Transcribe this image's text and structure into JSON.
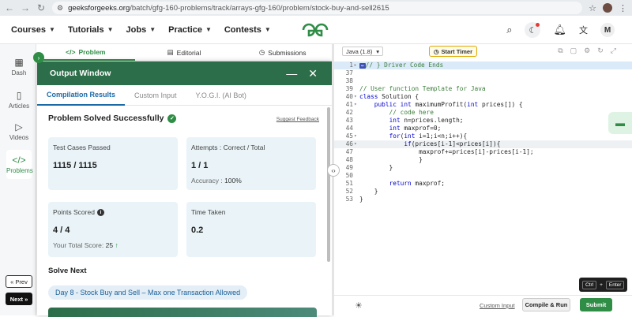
{
  "browser": {
    "url_host": "geeksforgeeks.org",
    "url_path": "/batch/gfg-160-problems/track/arrays-gfg-160/problem/stock-buy-and-sell2615"
  },
  "header": {
    "menu": [
      "Courses",
      "Tutorials",
      "Jobs",
      "Practice",
      "Contests"
    ],
    "avatar_letter": "M"
  },
  "rail": {
    "items": [
      "Dash",
      "Articles",
      "Videos",
      "Problems"
    ],
    "prev_label": "« Prev",
    "next_label": "Next »"
  },
  "problem_tabs": [
    "Problem",
    "Editorial",
    "Submissions"
  ],
  "output": {
    "title": "Output Window",
    "tabs": [
      "Compilation Results",
      "Custom Input",
      "Y.O.G.I. (AI Bot)"
    ],
    "result_title": "Problem Solved Successfully",
    "feedback": "Suggest Feedback",
    "cards": {
      "test_label": "Test Cases Passed",
      "test_value": "1115 / 1115",
      "attempts_label": "Attempts : Correct / Total",
      "attempts_value": "1 / 1",
      "accuracy_label": "Accuracy :",
      "accuracy_value": "100%",
      "points_label": "Points Scored",
      "points_value": "4 / 4",
      "total_label": "Your Total Score:",
      "total_value": "25",
      "time_label": "Time Taken",
      "time_value": "0.2"
    },
    "solve_next": "Solve Next",
    "next_problem": "Day 8 - Stock Buy and Sell – Max one Transaction Allowed"
  },
  "editor": {
    "language": "Java (1.8)",
    "timer_label": "Start Timer",
    "lines": [
      {
        "n": "1",
        "fold": "▸",
        "code": "// } Driver Code Ends",
        "badge": "↔"
      },
      {
        "n": "37",
        "fold": "",
        "code": ""
      },
      {
        "n": "38",
        "fold": "",
        "code": ""
      },
      {
        "n": "39",
        "fold": "",
        "code": "// User function Template for Java"
      },
      {
        "n": "40",
        "fold": "▾",
        "code": "class Solution {"
      },
      {
        "n": "41",
        "fold": "▾",
        "code": "    public int maximumProfit(int prices[]) {"
      },
      {
        "n": "42",
        "fold": "",
        "code": "        // code here"
      },
      {
        "n": "43",
        "fold": "",
        "code": "        int n=prices.length;"
      },
      {
        "n": "44",
        "fold": "",
        "code": "        int maxprof=0;"
      },
      {
        "n": "45",
        "fold": "▾",
        "code": "        for(int i=1;i<n;i++){"
      },
      {
        "n": "46",
        "fold": "▾",
        "code": "            if(prices[i-1]<prices[i]){"
      },
      {
        "n": "47",
        "fold": "",
        "code": "                maxprof+=prices[i]-prices[i-1];"
      },
      {
        "n": "48",
        "fold": "",
        "code": "                }"
      },
      {
        "n": "49",
        "fold": "",
        "code": "        }"
      },
      {
        "n": "50",
        "fold": "",
        "code": ""
      },
      {
        "n": "51",
        "fold": "",
        "code": "        return maxprof;"
      },
      {
        "n": "52",
        "fold": "",
        "code": "    }"
      },
      {
        "n": "53",
        "fold": "",
        "code": "}"
      }
    ],
    "custom_input": "Custom Input",
    "compile_label": "Compile & Run",
    "submit_label": "Submit",
    "kbd": [
      "Ctrl",
      "+",
      "Enter"
    ]
  },
  "colors": {
    "brand_green": "#2f8d46",
    "header_green": "#2c6e49",
    "card_bg": "#e9f3f8"
  }
}
